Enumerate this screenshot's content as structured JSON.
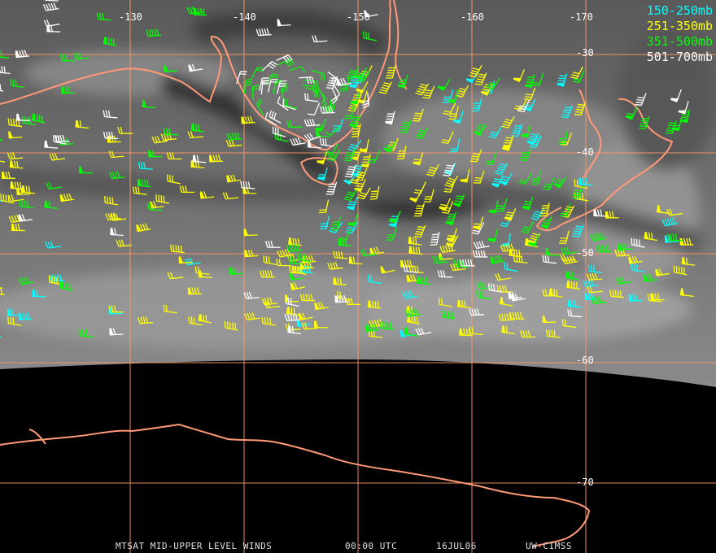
{
  "map": {
    "longitude_labels": [
      "-130",
      "-140",
      "-150",
      "-160",
      "-170"
    ],
    "latitude_labels": [
      "-30",
      "-40",
      "-50",
      "-60",
      "-70"
    ]
  },
  "legend": [
    {
      "label": "150-250mb",
      "color": "#00ffff"
    },
    {
      "label": "251-350mb",
      "color": "#ffff00"
    },
    {
      "label": "351-500mb",
      "color": "#00ff00"
    },
    {
      "label": "501-700mb",
      "color": "#ffffff"
    }
  ],
  "caption": {
    "product": "MTSAT MID-UPPER LEVEL WINDS",
    "time": "00:00 UTC",
    "date": "16JUL06",
    "source": "UW-CIMSS"
  },
  "colors": {
    "grid": "#ff9966",
    "coast": "#ff9977"
  }
}
